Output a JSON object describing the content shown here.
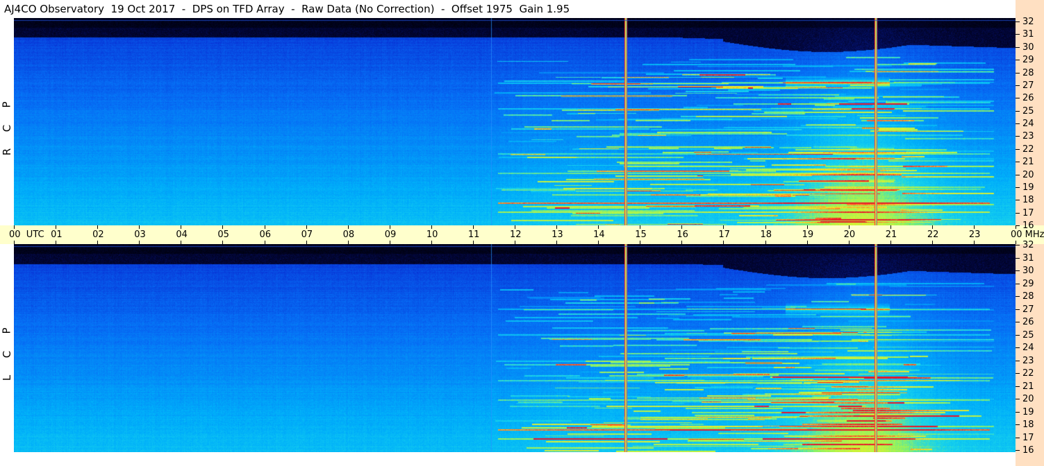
{
  "header": {
    "title": "AJ4CO Observatory  19 Oct 2017  -  DPS on TFD Array  -  Raw Data (No Correction)  -  Offset 1975  Gain 1.95"
  },
  "panels": [
    {
      "id": "top",
      "polarization": [
        "R",
        "C",
        "P"
      ]
    },
    {
      "id": "bottom",
      "polarization": [
        "L",
        "C",
        "P"
      ]
    }
  ],
  "time_axis": {
    "labels": [
      "00  UTC",
      "01",
      "02",
      "03",
      "04",
      "05",
      "06",
      "07",
      "08",
      "09",
      "10",
      "11",
      "12",
      "13",
      "14",
      "15",
      "16",
      "17",
      "18",
      "19",
      "20",
      "21",
      "22",
      "23",
      "00"
    ]
  },
  "freq_axis": {
    "unit": "MHz",
    "labels": [
      "32",
      "31",
      "30",
      "29",
      "28",
      "27",
      "26",
      "25",
      "24",
      "23",
      "22",
      "21",
      "20",
      "19",
      "18",
      "17",
      "16"
    ]
  },
  "colors": {
    "time_axis_bg": "#ffffcc",
    "freq_axis_bg": "#ffe0c2",
    "noise_floor": "#0a3fd8",
    "quiet_band": "#02063a",
    "strong_signal": "#9cf35a",
    "interference": "#ff2020"
  },
  "chart_data": {
    "type": "heatmap",
    "title": "AJ4CO Observatory  19 Oct 2017  -  DPS on TFD Array  -  Raw Data (No Correction)  -  Offset 1975  Gain 1.95",
    "x": {
      "label": "UTC",
      "unit": "hours",
      "range": [
        0,
        24
      ],
      "ticks": [
        "00",
        "01",
        "02",
        "03",
        "04",
        "05",
        "06",
        "07",
        "08",
        "09",
        "10",
        "11",
        "12",
        "13",
        "14",
        "15",
        "16",
        "17",
        "18",
        "19",
        "20",
        "21",
        "22",
        "23",
        "00"
      ]
    },
    "y": {
      "label": "MHz",
      "unit": "MHz",
      "range": [
        16,
        32
      ],
      "ticks": [
        32,
        31,
        30,
        29,
        28,
        27,
        26,
        25,
        24,
        23,
        22,
        21,
        20,
        19,
        18,
        17,
        16
      ]
    },
    "series": [
      {
        "name": "RCP",
        "panel": "top"
      },
      {
        "name": "LCP",
        "panel": "bottom"
      }
    ],
    "features": {
      "vertical_interference_hours": [
        11.45,
        14.65,
        20.65
      ],
      "persistent_rfi_mhz": [
        27.0,
        25.0,
        21.5,
        20.0,
        17.7,
        17.0
      ],
      "strong_emission_window_utc": [
        17.5,
        22.5
      ],
      "strong_emission_band_mhz": [
        16,
        28
      ]
    },
    "legend": "none",
    "grid": false
  }
}
